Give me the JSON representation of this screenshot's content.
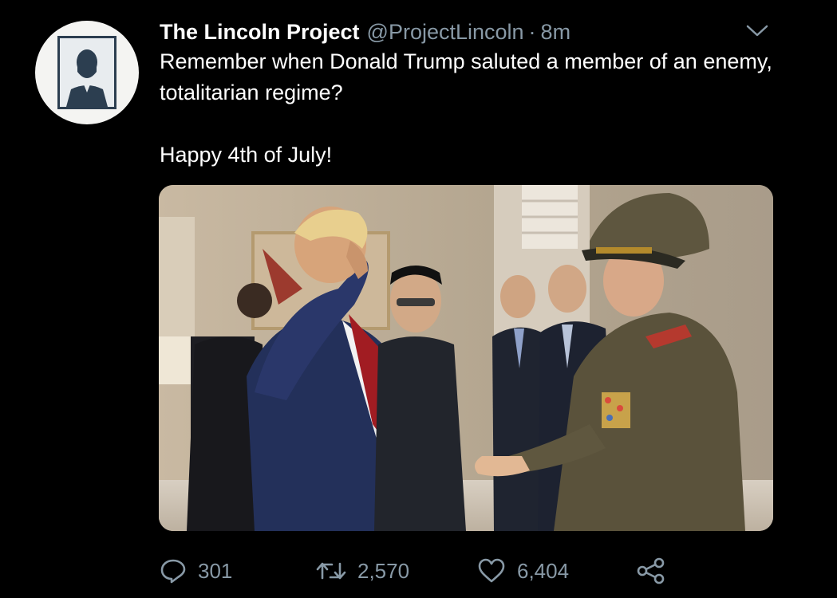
{
  "tweet": {
    "author_name": "The Lincoln Project",
    "handle": "@ProjectLincoln",
    "separator": "·",
    "time": "8m",
    "text_line1": "Remember when Donald Trump saluted a member of an enemy, totalitarian regime?",
    "text_line2": "Happy 4th of July!"
  },
  "actions": {
    "replies": "301",
    "retweets": "2,570",
    "likes": "6,404"
  },
  "colors": {
    "background": "#000000",
    "primary_text": "#ffffff",
    "secondary_text": "#8899a6"
  },
  "icons": [
    "avatar-lincoln-portrait",
    "chevron-down-icon",
    "reply-icon",
    "retweet-icon",
    "like-icon",
    "share-icon"
  ]
}
